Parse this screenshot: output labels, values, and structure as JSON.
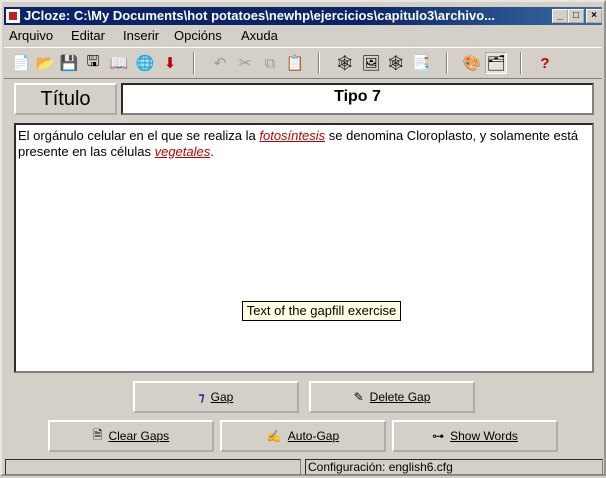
{
  "window": {
    "title": "JCloze: C:\\My Documents\\hot potatoes\\newhp\\ejercicios\\capitulo3\\archivo..."
  },
  "titlebar_buttons": {
    "minimize": "_",
    "maximize": "□",
    "close": "×"
  },
  "menu": {
    "items": [
      "Arquivo",
      "Editar",
      "Inserir",
      "Opcións",
      "Axuda"
    ]
  },
  "toolbar": {
    "icons": [
      "new-file-icon",
      "open-folder-icon",
      "save-icon",
      "save-as-icon",
      "book-icon",
      "web-icon",
      "download-icon",
      "undo-icon",
      "cut-icon",
      "copy-icon",
      "paste-icon",
      "export-web-icon",
      "export-image-icon",
      "export-flash-icon",
      "export-xml-icon",
      "palette-icon",
      "config-icon",
      "help-icon"
    ]
  },
  "title_label": "Título",
  "title_value": "Tipo 7",
  "editor": {
    "segments": [
      {
        "text": "El orgánulo celular en el que se realiza la ",
        "gap": false
      },
      {
        "text": "fotosíntesis",
        "gap": true
      },
      {
        "text": " se denomina Cloroplasto, y solamente está presente en las células ",
        "gap": false
      },
      {
        "text": "vegetales",
        "gap": true
      },
      {
        "text": ".",
        "gap": false
      }
    ],
    "tooltip": "Text of the gapfill exercise"
  },
  "buttons": {
    "gap": "Gap",
    "delete_gap": "Delete Gap",
    "clear_gaps": "Clear Gaps",
    "auto_gap": "Auto-Gap",
    "show_words": "Show Words"
  },
  "status": {
    "config": "Configuración: english6.cfg"
  },
  "colors": {
    "titlebar": "#0a246a",
    "gap_text": "#c00000",
    "face": "#d4d0c8"
  }
}
